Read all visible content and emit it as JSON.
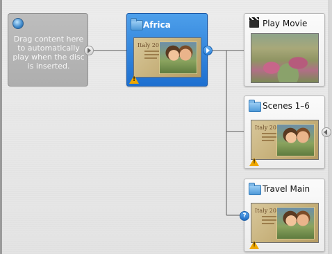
{
  "first_play": {
    "message": "Drag content here to automatically play when the disc is inserted.",
    "icon": "globe-icon"
  },
  "menu": {
    "title": "Africa",
    "icon": "folder-icon",
    "thumb_text": "Italy 2006",
    "accent_color": "#2a7fdc"
  },
  "nodes": [
    {
      "title": "Play Movie",
      "icon": "movie-clapper-icon"
    },
    {
      "title": "Scenes 1–6",
      "icon": "folder-icon",
      "thumb_text": "Italy 2006"
    },
    {
      "title": "Travel Main",
      "icon": "folder-icon",
      "thumb_text": "Italy 2006"
    }
  ],
  "warning_symbol": "!",
  "help_symbol": "?",
  "colors": {
    "link_line": "#5a5a5a",
    "warning": "#f0a800"
  }
}
